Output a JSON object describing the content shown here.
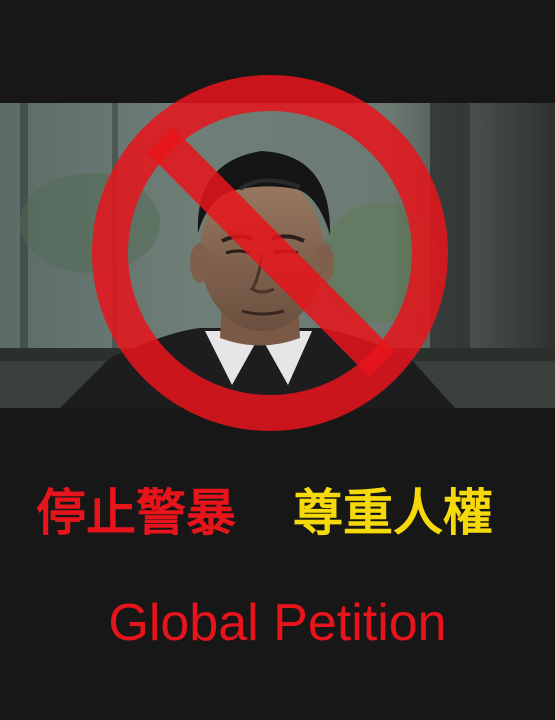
{
  "poster": {
    "slogan_left": "停止警暴",
    "slogan_right": "尊重人權",
    "headline": "Global Petition"
  },
  "colors": {
    "background": "#171717",
    "red": "#e8141b",
    "yellow": "#f5d90a"
  },
  "icons": {
    "ban": "prohibition-sign-icon"
  }
}
